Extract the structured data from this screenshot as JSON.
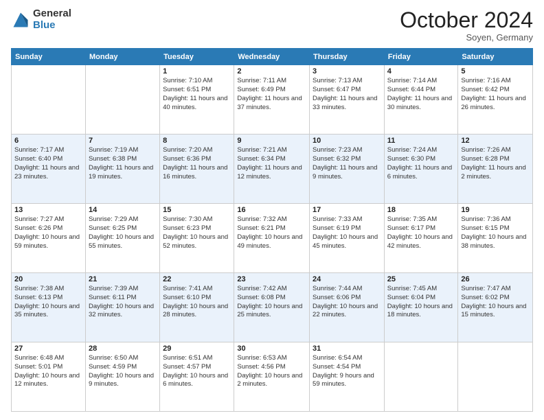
{
  "header": {
    "logo_general": "General",
    "logo_blue": "Blue",
    "month": "October 2024",
    "location": "Soyen, Germany"
  },
  "weekdays": [
    "Sunday",
    "Monday",
    "Tuesday",
    "Wednesday",
    "Thursday",
    "Friday",
    "Saturday"
  ],
  "weeks": [
    [
      {
        "day": "",
        "sunrise": "",
        "sunset": "",
        "daylight": ""
      },
      {
        "day": "",
        "sunrise": "",
        "sunset": "",
        "daylight": ""
      },
      {
        "day": "1",
        "sunrise": "Sunrise: 7:10 AM",
        "sunset": "Sunset: 6:51 PM",
        "daylight": "Daylight: 11 hours and 40 minutes."
      },
      {
        "day": "2",
        "sunrise": "Sunrise: 7:11 AM",
        "sunset": "Sunset: 6:49 PM",
        "daylight": "Daylight: 11 hours and 37 minutes."
      },
      {
        "day": "3",
        "sunrise": "Sunrise: 7:13 AM",
        "sunset": "Sunset: 6:47 PM",
        "daylight": "Daylight: 11 hours and 33 minutes."
      },
      {
        "day": "4",
        "sunrise": "Sunrise: 7:14 AM",
        "sunset": "Sunset: 6:44 PM",
        "daylight": "Daylight: 11 hours and 30 minutes."
      },
      {
        "day": "5",
        "sunrise": "Sunrise: 7:16 AM",
        "sunset": "Sunset: 6:42 PM",
        "daylight": "Daylight: 11 hours and 26 minutes."
      }
    ],
    [
      {
        "day": "6",
        "sunrise": "Sunrise: 7:17 AM",
        "sunset": "Sunset: 6:40 PM",
        "daylight": "Daylight: 11 hours and 23 minutes."
      },
      {
        "day": "7",
        "sunrise": "Sunrise: 7:19 AM",
        "sunset": "Sunset: 6:38 PM",
        "daylight": "Daylight: 11 hours and 19 minutes."
      },
      {
        "day": "8",
        "sunrise": "Sunrise: 7:20 AM",
        "sunset": "Sunset: 6:36 PM",
        "daylight": "Daylight: 11 hours and 16 minutes."
      },
      {
        "day": "9",
        "sunrise": "Sunrise: 7:21 AM",
        "sunset": "Sunset: 6:34 PM",
        "daylight": "Daylight: 11 hours and 12 minutes."
      },
      {
        "day": "10",
        "sunrise": "Sunrise: 7:23 AM",
        "sunset": "Sunset: 6:32 PM",
        "daylight": "Daylight: 11 hours and 9 minutes."
      },
      {
        "day": "11",
        "sunrise": "Sunrise: 7:24 AM",
        "sunset": "Sunset: 6:30 PM",
        "daylight": "Daylight: 11 hours and 6 minutes."
      },
      {
        "day": "12",
        "sunrise": "Sunrise: 7:26 AM",
        "sunset": "Sunset: 6:28 PM",
        "daylight": "Daylight: 11 hours and 2 minutes."
      }
    ],
    [
      {
        "day": "13",
        "sunrise": "Sunrise: 7:27 AM",
        "sunset": "Sunset: 6:26 PM",
        "daylight": "Daylight: 10 hours and 59 minutes."
      },
      {
        "day": "14",
        "sunrise": "Sunrise: 7:29 AM",
        "sunset": "Sunset: 6:25 PM",
        "daylight": "Daylight: 10 hours and 55 minutes."
      },
      {
        "day": "15",
        "sunrise": "Sunrise: 7:30 AM",
        "sunset": "Sunset: 6:23 PM",
        "daylight": "Daylight: 10 hours and 52 minutes."
      },
      {
        "day": "16",
        "sunrise": "Sunrise: 7:32 AM",
        "sunset": "Sunset: 6:21 PM",
        "daylight": "Daylight: 10 hours and 49 minutes."
      },
      {
        "day": "17",
        "sunrise": "Sunrise: 7:33 AM",
        "sunset": "Sunset: 6:19 PM",
        "daylight": "Daylight: 10 hours and 45 minutes."
      },
      {
        "day": "18",
        "sunrise": "Sunrise: 7:35 AM",
        "sunset": "Sunset: 6:17 PM",
        "daylight": "Daylight: 10 hours and 42 minutes."
      },
      {
        "day": "19",
        "sunrise": "Sunrise: 7:36 AM",
        "sunset": "Sunset: 6:15 PM",
        "daylight": "Daylight: 10 hours and 38 minutes."
      }
    ],
    [
      {
        "day": "20",
        "sunrise": "Sunrise: 7:38 AM",
        "sunset": "Sunset: 6:13 PM",
        "daylight": "Daylight: 10 hours and 35 minutes."
      },
      {
        "day": "21",
        "sunrise": "Sunrise: 7:39 AM",
        "sunset": "Sunset: 6:11 PM",
        "daylight": "Daylight: 10 hours and 32 minutes."
      },
      {
        "day": "22",
        "sunrise": "Sunrise: 7:41 AM",
        "sunset": "Sunset: 6:10 PM",
        "daylight": "Daylight: 10 hours and 28 minutes."
      },
      {
        "day": "23",
        "sunrise": "Sunrise: 7:42 AM",
        "sunset": "Sunset: 6:08 PM",
        "daylight": "Daylight: 10 hours and 25 minutes."
      },
      {
        "day": "24",
        "sunrise": "Sunrise: 7:44 AM",
        "sunset": "Sunset: 6:06 PM",
        "daylight": "Daylight: 10 hours and 22 minutes."
      },
      {
        "day": "25",
        "sunrise": "Sunrise: 7:45 AM",
        "sunset": "Sunset: 6:04 PM",
        "daylight": "Daylight: 10 hours and 18 minutes."
      },
      {
        "day": "26",
        "sunrise": "Sunrise: 7:47 AM",
        "sunset": "Sunset: 6:02 PM",
        "daylight": "Daylight: 10 hours and 15 minutes."
      }
    ],
    [
      {
        "day": "27",
        "sunrise": "Sunrise: 6:48 AM",
        "sunset": "Sunset: 5:01 PM",
        "daylight": "Daylight: 10 hours and 12 minutes."
      },
      {
        "day": "28",
        "sunrise": "Sunrise: 6:50 AM",
        "sunset": "Sunset: 4:59 PM",
        "daylight": "Daylight: 10 hours and 9 minutes."
      },
      {
        "day": "29",
        "sunrise": "Sunrise: 6:51 AM",
        "sunset": "Sunset: 4:57 PM",
        "daylight": "Daylight: 10 hours and 6 minutes."
      },
      {
        "day": "30",
        "sunrise": "Sunrise: 6:53 AM",
        "sunset": "Sunset: 4:56 PM",
        "daylight": "Daylight: 10 hours and 2 minutes."
      },
      {
        "day": "31",
        "sunrise": "Sunrise: 6:54 AM",
        "sunset": "Sunset: 4:54 PM",
        "daylight": "Daylight: 9 hours and 59 minutes."
      },
      {
        "day": "",
        "sunrise": "",
        "sunset": "",
        "daylight": ""
      },
      {
        "day": "",
        "sunrise": "",
        "sunset": "",
        "daylight": ""
      }
    ]
  ]
}
